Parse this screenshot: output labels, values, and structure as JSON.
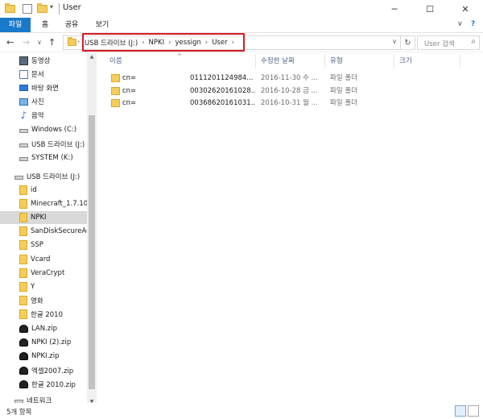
{
  "window": {
    "title": "User",
    "minimize": "─",
    "maximize": "☐",
    "close": "✕"
  },
  "ribbon": {
    "tabs": [
      "파일",
      "홈",
      "공유",
      "보기"
    ],
    "chevron": "∨",
    "help": "?"
  },
  "address": {
    "back": "←",
    "forward": "→",
    "dropdown": "∨",
    "up": "↑",
    "crumbs": [
      "USB 드라이브 (J:)",
      "NPKI",
      "yessign",
      "User"
    ],
    "history": "∨",
    "refresh": "↻",
    "search_placeholder": "User 검색",
    "search_icon": "search-icon"
  },
  "sidebar": {
    "items": [
      {
        "label": "동영상",
        "icon": "video-icon"
      },
      {
        "label": "문서",
        "icon": "document-icon"
      },
      {
        "label": "바탕 화면",
        "icon": "desktop-icon"
      },
      {
        "label": "사진",
        "icon": "pictures-icon"
      },
      {
        "label": "음악",
        "icon": "music-icon"
      },
      {
        "label": "Windows (C:)",
        "icon": "drive-icon"
      },
      {
        "label": "USB 드라이브 (J:)",
        "icon": "usb-drive-icon"
      },
      {
        "label": "SYSTEM (K:)",
        "icon": "drive-icon"
      },
      {
        "label": "USB 드라이브 (J:)",
        "icon": "usb-drive-icon"
      },
      {
        "label": "id",
        "icon": "folder-icon"
      },
      {
        "label": "Minecraft_1.7.10",
        "icon": "folder-icon"
      },
      {
        "label": "NPKI",
        "icon": "folder-icon",
        "selected": true
      },
      {
        "label": "SanDiskSecureAccess",
        "icon": "folder-icon"
      },
      {
        "label": "SSP",
        "icon": "folder-icon"
      },
      {
        "label": "Vcard",
        "icon": "folder-icon"
      },
      {
        "label": "VeraCrypt",
        "icon": "folder-icon"
      },
      {
        "label": "Y",
        "icon": "folder-icon"
      },
      {
        "label": "영화",
        "icon": "folder-icon"
      },
      {
        "label": "한글 2010",
        "icon": "folder-icon"
      },
      {
        "label": "LAN.zip",
        "icon": "zip-icon"
      },
      {
        "label": "NPKI (2).zip",
        "icon": "zip-icon"
      },
      {
        "label": "NPKI.zip",
        "icon": "zip-icon"
      },
      {
        "label": "엑셀2007.zip",
        "icon": "zip-icon"
      },
      {
        "label": "한글 2010.zip",
        "icon": "zip-icon"
      },
      {
        "label": "네트워크",
        "icon": "network-icon"
      }
    ]
  },
  "columns": {
    "name": "이름",
    "modified": "수정한 날짜",
    "type": "유형",
    "size": "크기"
  },
  "files": [
    {
      "name": "cn=",
      "name_tail": "0111201124984...",
      "modified": "2016-11-30 수 ...",
      "type": "파일 폴더",
      "size": ""
    },
    {
      "name": "cn=",
      "name_tail": "00302620161028...",
      "modified": "2016-10-28 금 ...",
      "type": "파일 폴더",
      "size": ""
    },
    {
      "name": "cn=",
      "name_tail": "00368620161031...",
      "modified": "2016-10-31 월 ...",
      "type": "파일 폴더",
      "size": ""
    }
  ],
  "status": {
    "item_count": "5개 항목"
  }
}
